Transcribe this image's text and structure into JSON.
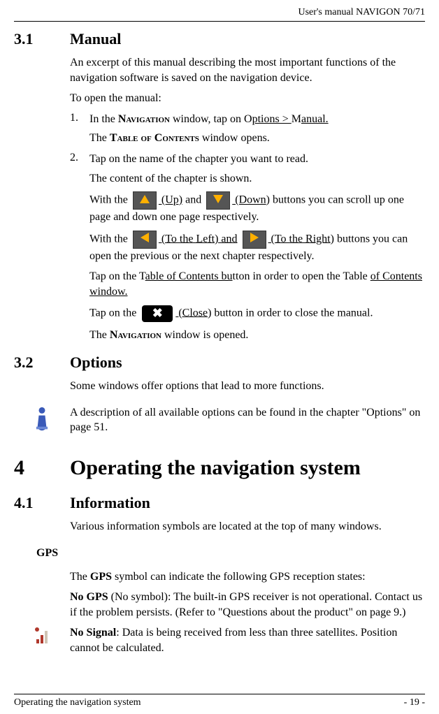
{
  "header": {
    "right": "User's manual NAVIGON 70/71"
  },
  "s31": {
    "num": "3.1",
    "title": "Manual",
    "p1": "An excerpt of this manual describing the most important functions of the navigation software is saved on the navigation device.",
    "p2": "To open the manual:",
    "li1_num": "1.",
    "li1_a": "In the ",
    "li1_nav": "Navigation",
    "li1_b": " window, tap on O",
    "li1_u1": "ptions > ",
    "li1_c": "M",
    "li1_u2": "anual.",
    "li1_sub_a": "The ",
    "li1_sub_sc": "Table of Contents",
    "li1_sub_b": " window opens.",
    "li2_num": "2.",
    "li2": "Tap on the name of the chapter you want to read.",
    "li2_sub": "The content of the chapter is shown.",
    "p3_a": "With the ",
    "p3_up_u": " (Up)",
    "p3_b": " and ",
    "p3_dn_u": " (Down",
    "p3_c": ") buttons you can scroll up one page and down one page respectively.",
    "p4_a": "With the ",
    "p4_l_u": "  (To the Left) and",
    "p4_b": " ",
    "p4_r_u": " (To the Right",
    "p4_c": ") buttons you can open the previous or the next chapter respectively.",
    "p5_a": "Tap on the T",
    "p5_u1": "able of Contents bu",
    "p5_b": "tton in order to open the Table ",
    "p5_u2": "of Contents window.",
    "p6_a": "Tap on the ",
    "p6_u": " (Close",
    "p6_b": ") button in order to close the manual.",
    "p7_a": "The ",
    "p7_nav": "Navigation",
    "p7_b": " window is opened."
  },
  "s32": {
    "num": "3.2",
    "title": "Options",
    "p1": "Some windows offer options that lead to more functions.",
    "note": "A description of all available options can be found in the chapter \"Options\" on page 51."
  },
  "ch4": {
    "num": "4",
    "title": "Operating the navigation system"
  },
  "s41": {
    "num": "4.1",
    "title": "Information",
    "p1": "Various information symbols are located at the top of many windows.",
    "gps_h": "GPS",
    "gps_p1_a": "The ",
    "gps_p1_b": "GPS",
    "gps_p1_c": " symbol can indicate the following GPS reception states:",
    "nogps_a": "No GPS",
    "nogps_b": " (No symbol): The built-in GPS receiver is not operational. Contact us if the problem persists. (Refer to \"Questions about the product\" on page 9.)",
    "nosig_a": "No Signal",
    "nosig_b": ": Data is being received from less than three satellites. Position cannot be calculated."
  },
  "footer": {
    "left": "Operating the navigation system",
    "right": "- 19 -"
  }
}
